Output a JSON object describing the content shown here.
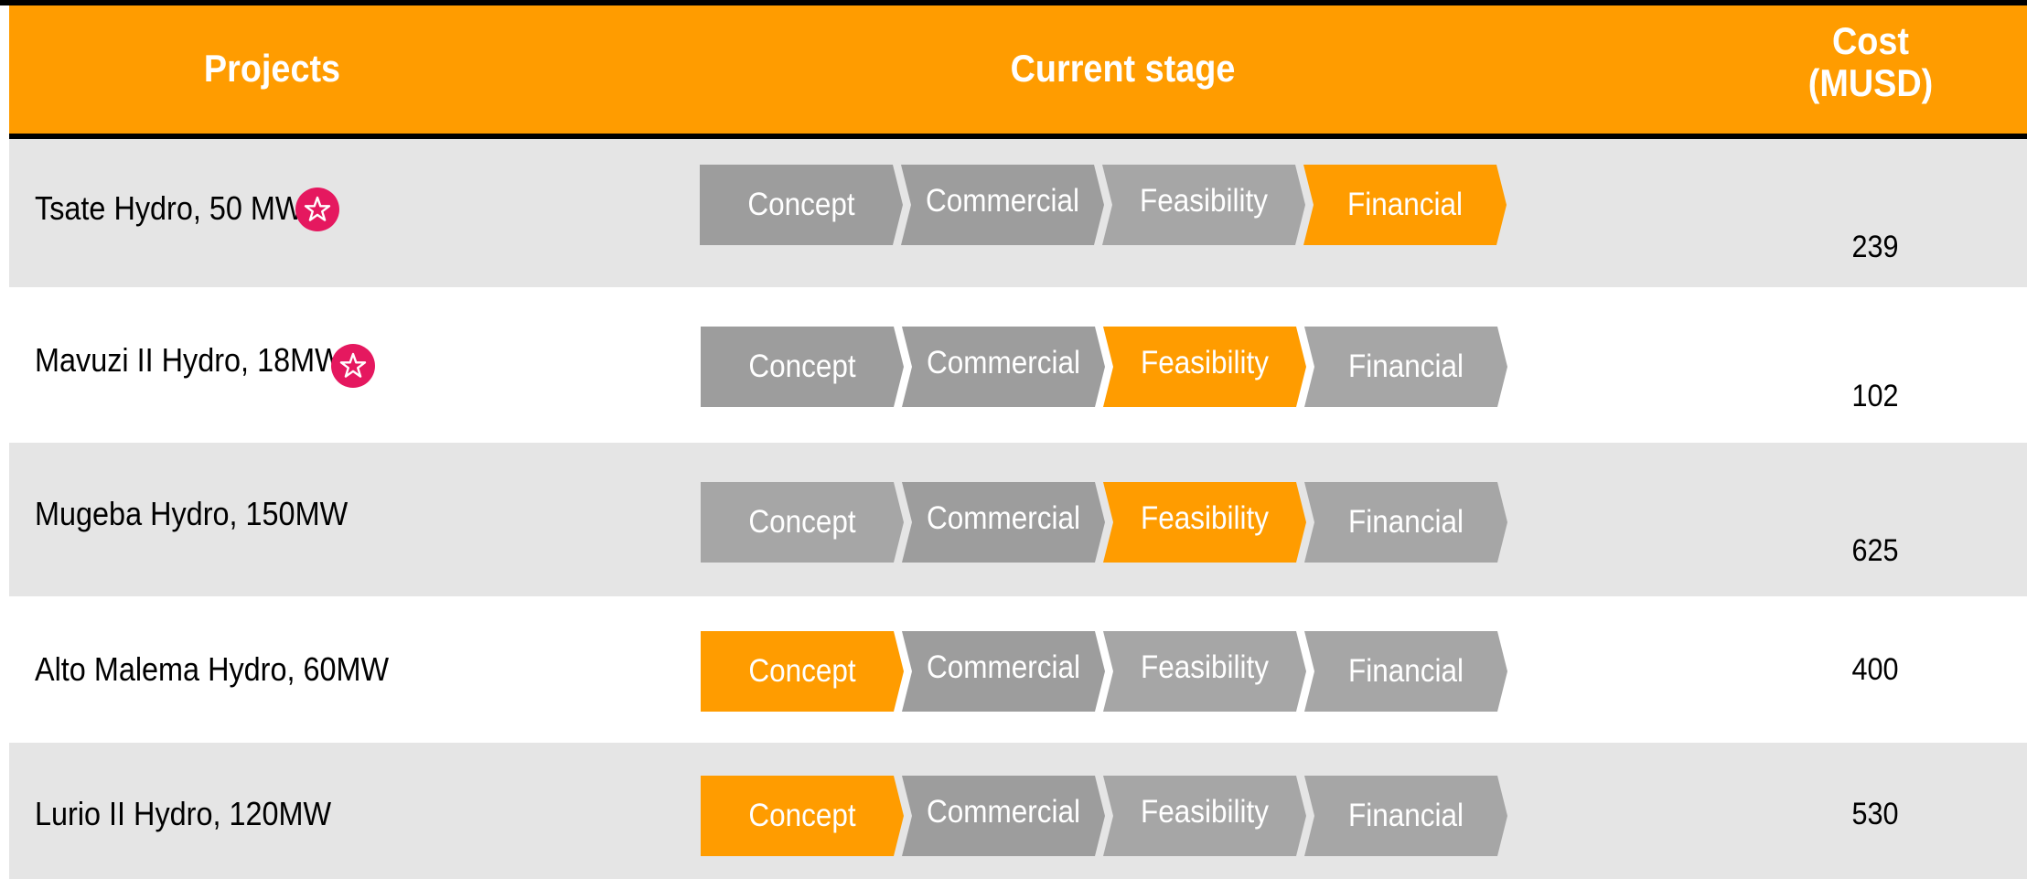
{
  "header": {
    "projects": "Projects",
    "current_stage": "Current stage",
    "cost": "Cost\n(MUSD)"
  },
  "colors": {
    "accent": "#ff9c00",
    "inactive_stage": "#a6a6a6",
    "row_shade": "#e5e5e5",
    "star_badge": "#e5185f"
  },
  "stages": [
    "Concept",
    "Commercial",
    "Feasibility",
    "Financial"
  ],
  "projects": [
    {
      "name": "Tsate Hydro, 50 MW",
      "starred": true,
      "current_stage": "Financial",
      "cost": "239",
      "star_icon": "star-icon"
    },
    {
      "name": "Mavuzi II Hydro, 18MW",
      "starred": true,
      "current_stage": "Feasibility",
      "cost": "102",
      "star_icon": "star-icon"
    },
    {
      "name": "Mugeba Hydro, 150MW",
      "starred": false,
      "current_stage": "Feasibility",
      "cost": "625"
    },
    {
      "name": "Alto Malema Hydro, 60MW",
      "starred": false,
      "current_stage": "Concept",
      "cost": "400"
    },
    {
      "name": "Lurio II Hydro, 120MW",
      "starred": false,
      "current_stage": "Concept",
      "cost": "530"
    }
  ]
}
